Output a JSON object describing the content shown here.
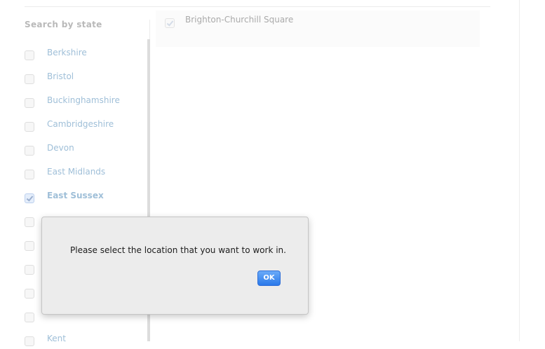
{
  "filters": {
    "title": "Search by state",
    "states": [
      {
        "label": "Berkshire",
        "checked": false
      },
      {
        "label": "Bristol",
        "checked": false
      },
      {
        "label": "Buckinghamshire",
        "checked": false
      },
      {
        "label": "Cambridgeshire",
        "checked": false
      },
      {
        "label": "Devon",
        "checked": false
      },
      {
        "label": "East Midlands",
        "checked": false
      },
      {
        "label": "East Sussex",
        "checked": true
      },
      {
        "label": "",
        "checked": false
      },
      {
        "label": "",
        "checked": false
      },
      {
        "label": "",
        "checked": false
      },
      {
        "label": "",
        "checked": false
      },
      {
        "label": "",
        "checked": false
      },
      {
        "label": "Kent",
        "checked": false
      }
    ]
  },
  "locations": {
    "items": [
      {
        "label": "Brighton-Churchill Square",
        "checked": true
      }
    ]
  },
  "dialog": {
    "message": "Please select the location that you want to work in.",
    "ok_label": "OK"
  }
}
